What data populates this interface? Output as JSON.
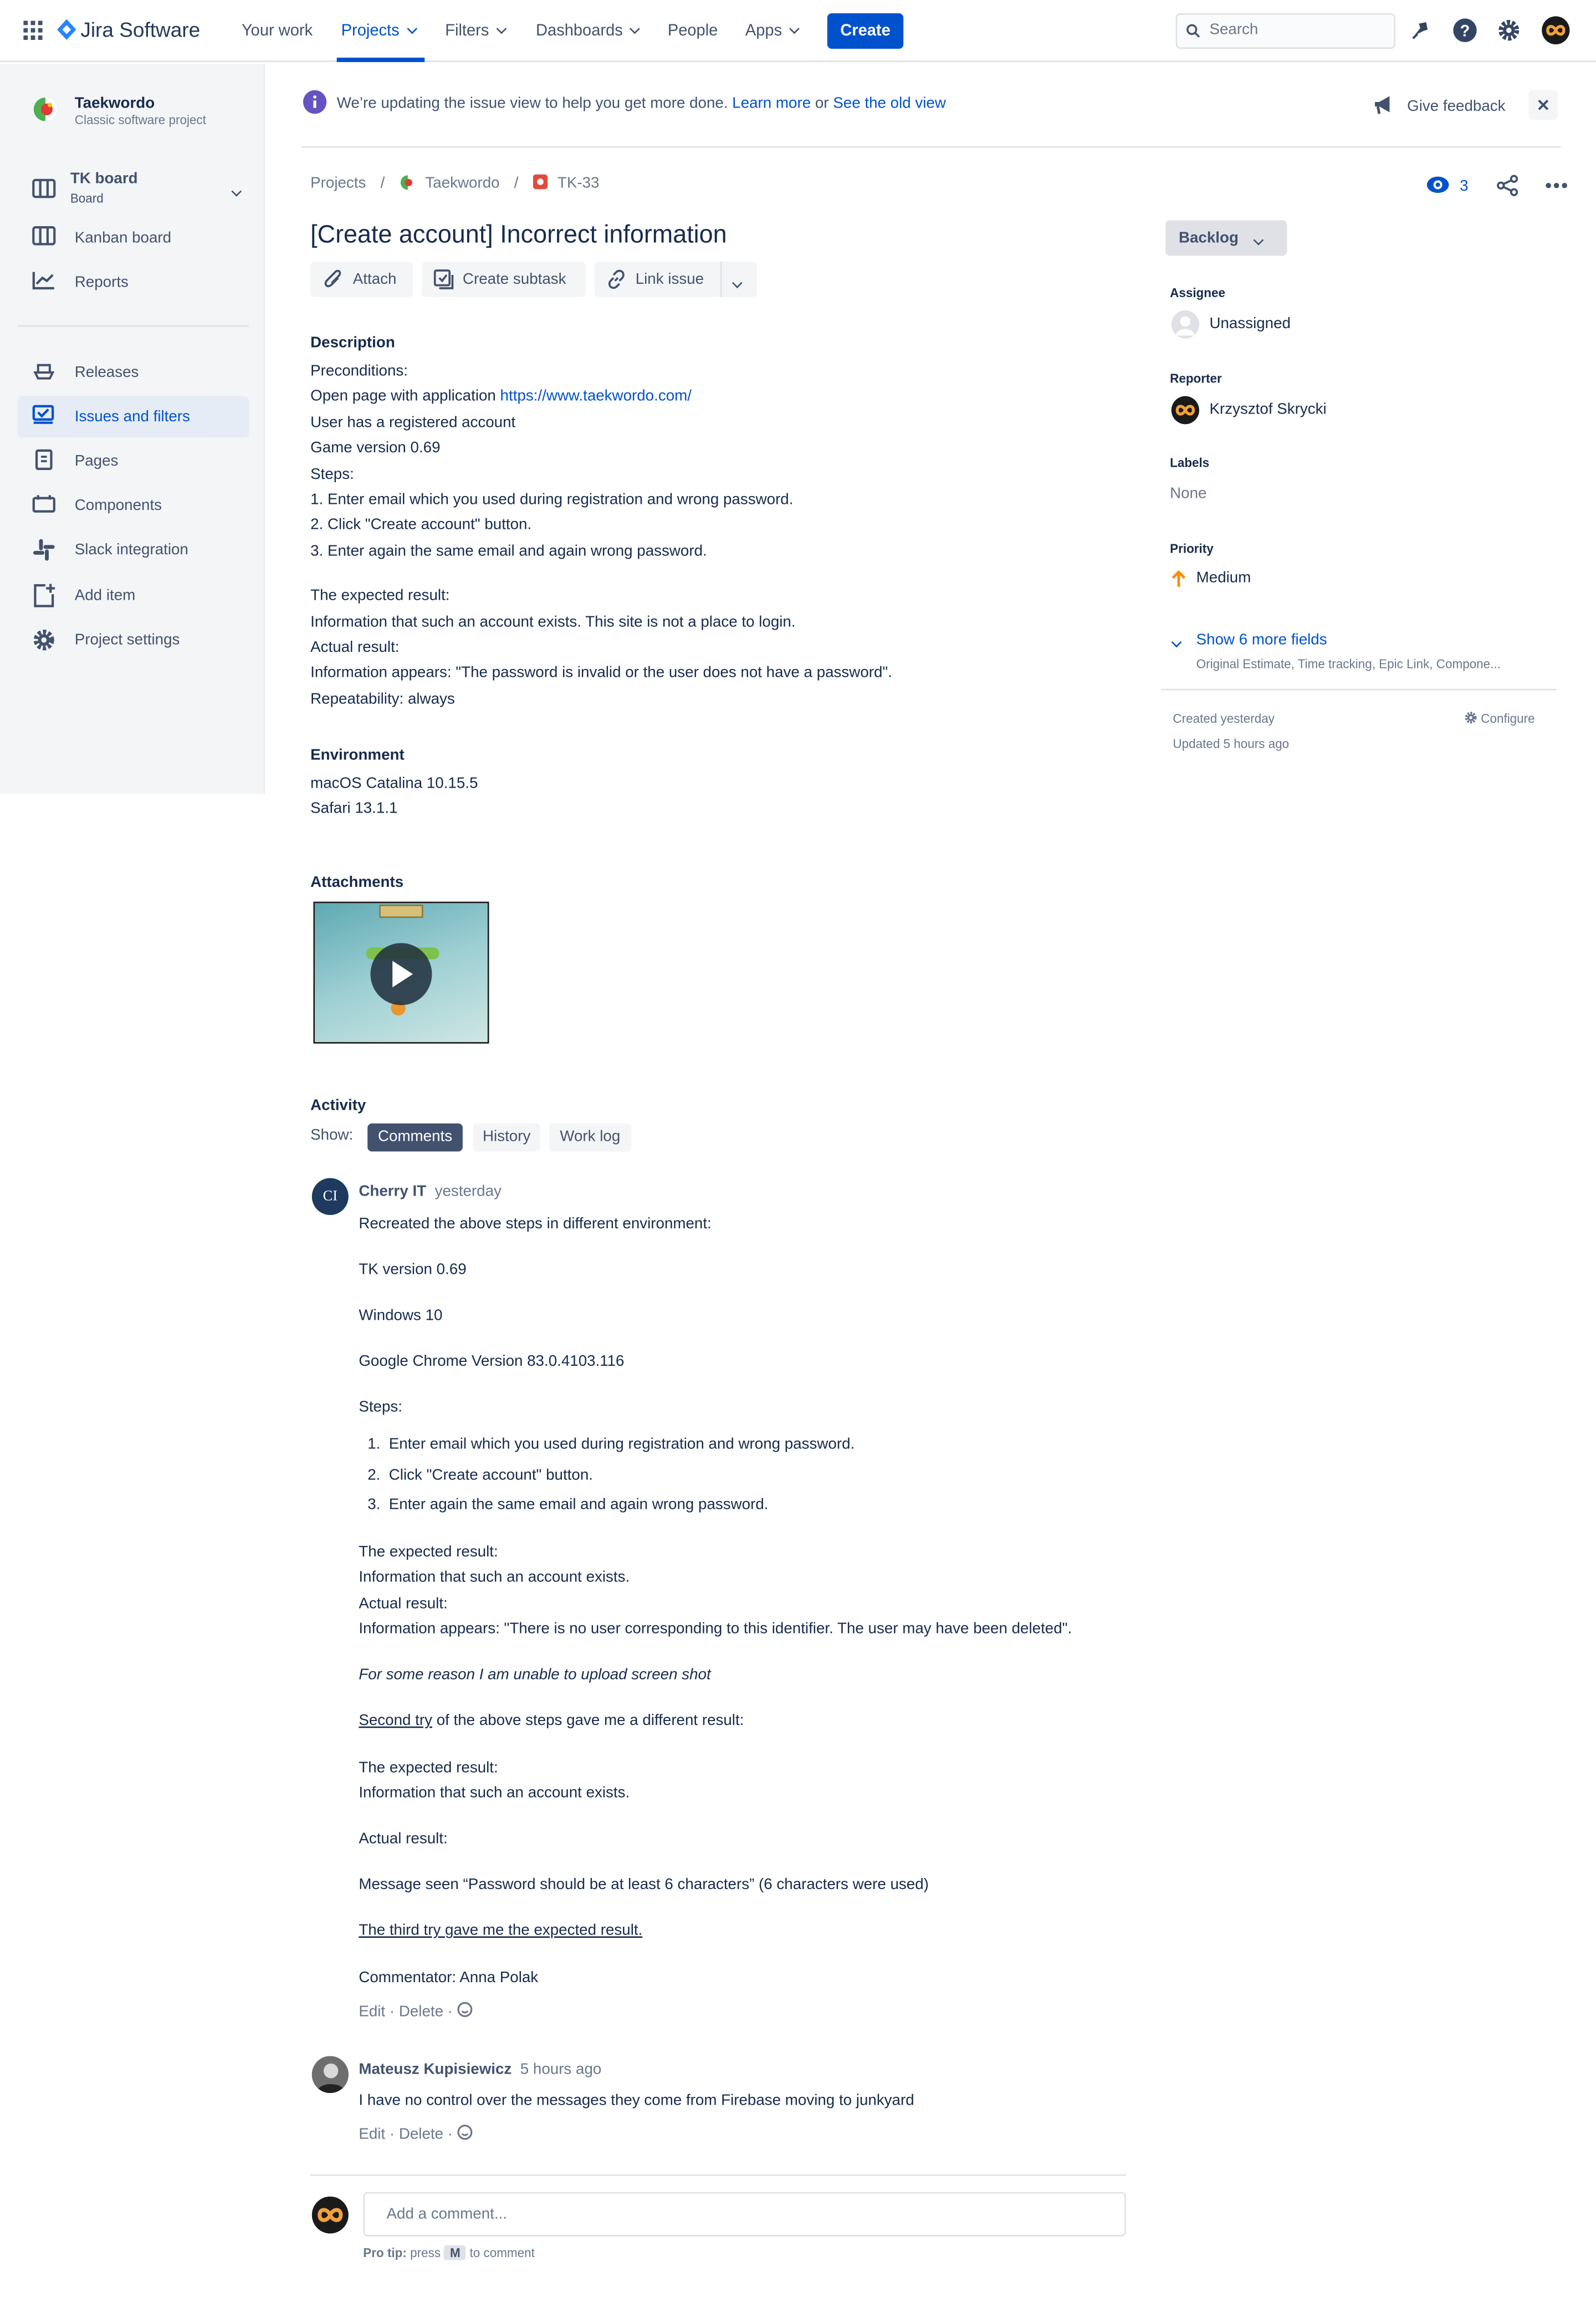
{
  "nav": {
    "brand": "Jira Software",
    "your_work": "Your work",
    "projects": "Projects",
    "filters": "Filters",
    "dashboards": "Dashboards",
    "people": "People",
    "apps": "Apps",
    "create": "Create",
    "search_placeholder": "Search"
  },
  "sidebar": {
    "project_name": "Taekwordo",
    "project_type": "Classic software project",
    "board_name": "TK board",
    "board_sub": "Board",
    "items": [
      {
        "label": "Kanban board",
        "icon": "kanban-board-icon"
      },
      {
        "label": "Reports",
        "icon": "reports-icon"
      },
      {
        "label": "Releases",
        "icon": "releases-icon"
      },
      {
        "label": "Issues and filters",
        "icon": "issues-icon",
        "active": true
      },
      {
        "label": "Pages",
        "icon": "pages-icon"
      },
      {
        "label": "Components",
        "icon": "components-icon"
      },
      {
        "label": "Slack integration",
        "icon": "slack-icon"
      },
      {
        "label": "Add item",
        "icon": "add-item-icon"
      },
      {
        "label": "Project settings",
        "icon": "gear-icon"
      }
    ]
  },
  "banner": {
    "text": "We’re updating the issue view to help you get more done.",
    "learn_more": "Learn more",
    "or": "or",
    "old_view": "See the old view",
    "feedback": "Give feedback"
  },
  "breadcrumb": {
    "projects": "Projects",
    "project": "Taekwordo",
    "issue": "TK-33"
  },
  "watchers": "3",
  "issue": {
    "title": "[Create account] Incorrect information",
    "actions": {
      "attach": "Attach",
      "subtask": "Create subtask",
      "link": "Link issue"
    },
    "description_label": "Description",
    "description": [
      "Preconditions:",
      "Open page with application ",
      "User has a registered account",
      "Game version 0.69",
      "Steps:",
      "1. Enter email which you used during registration and wrong password.",
      "2. Click \"Create account\" button.",
      "3. Enter again the same email and again wrong password."
    ],
    "url": "https://www.taekwordo.com/",
    "description2": [
      "The expected result:",
      "Information that such an account exists. This site is not a place to login.",
      "Actual result:",
      "Information appears: \"The password is invalid or the user does not have a password\".",
      "Repeatability: always"
    ],
    "environment_label": "Environment",
    "environment": [
      "macOS Catalina 10.15.5",
      "Safari 13.1.1"
    ],
    "attachments_label": "Attachments",
    "activity_label": "Activity",
    "show_label": "Show:",
    "tabs": [
      "Comments",
      "History",
      "Work log"
    ]
  },
  "comments": [
    {
      "author": "Cherry IT",
      "initials": "CI",
      "time": "yesterday",
      "intro": "Recreated the above steps in different environment:",
      "env": [
        "TK version 0.69",
        "Windows 10",
        "Google Chrome Version 83.0.4103.116"
      ],
      "steps_label": "Steps:",
      "steps": [
        "Enter email which you used during registration and wrong password.",
        "Click \"Create account\" button.",
        "Enter again the same email and again wrong password."
      ],
      "result1": [
        "The expected result:",
        "Information that such an account exists.",
        "Actual result:",
        "Information appears: \"There is no user corresponding to this identifier. The user may have been deleted\"."
      ],
      "italic": "For some reason I am unable to upload screen shot",
      "second_try": "Second try",
      "second_rest": " of the above steps gave me a different result:",
      "result2": [
        "The expected result:",
        "Information that such an account exists."
      ],
      "actual": "Actual result:",
      "message": "Message seen “Password should be at least 6 characters” (6 characters were used)",
      "third": "The third try gave me the expected result.",
      "commentator": "Commentator: Anna Polak"
    },
    {
      "author": "Mateusz Kupisiewicz",
      "time": "5 hours ago",
      "text": "I have no control over the messages they come from Firebase moving to junkyard"
    }
  ],
  "comment_actions": {
    "edit": "Edit",
    "delete": "Delete"
  },
  "add_comment": {
    "placeholder": "Add a comment...",
    "tip_bold": "Pro tip:",
    "tip_press": "press",
    "tip_key": "M",
    "tip_rest": "to comment"
  },
  "details": {
    "status": "Backlog",
    "assignee_label": "Assignee",
    "assignee": "Unassigned",
    "reporter_label": "Reporter",
    "reporter": "Krzysztof Skrycki",
    "labels_label": "Labels",
    "labels": "None",
    "priority_label": "Priority",
    "priority": "Medium",
    "more_fields": "Show 6 more fields",
    "more_fields_sub": "Original Estimate, Time tracking, Epic Link, Compone...",
    "created": "Created yesterday",
    "updated": "Updated 5 hours ago",
    "configure": "Configure"
  },
  "colors": {
    "brand": "#0052CC",
    "sidebar_bg": "#F4F5F7",
    "priority": "#FF8B00",
    "bug": "#E5493A",
    "info": "#6554C0"
  }
}
